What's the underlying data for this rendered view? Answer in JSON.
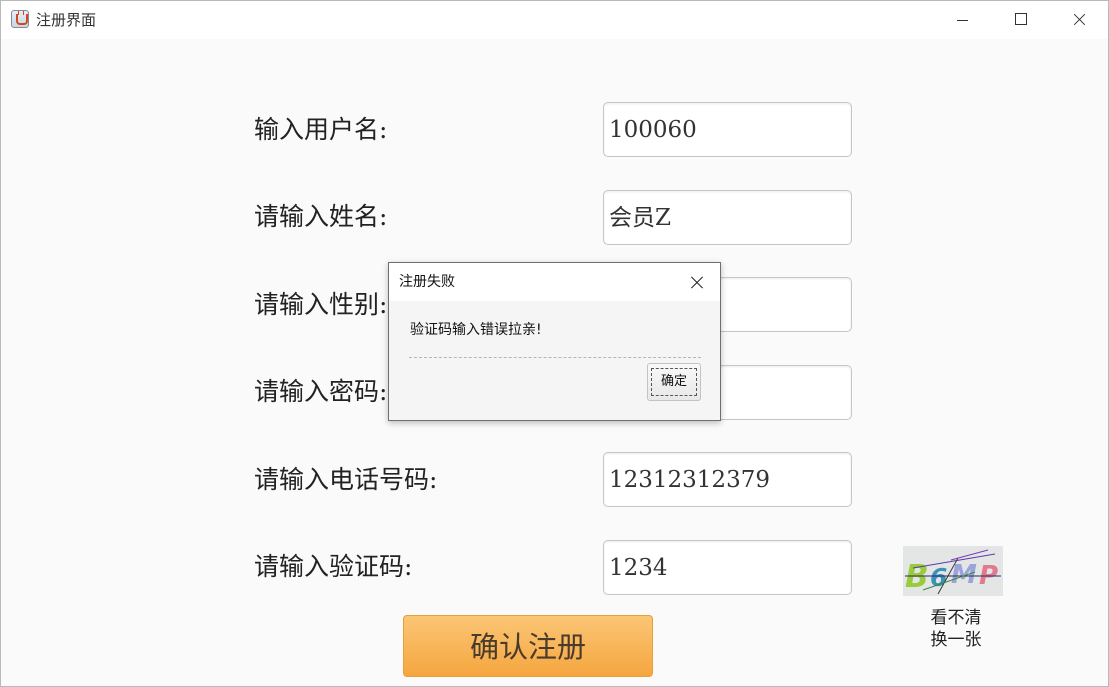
{
  "window": {
    "title": "注册界面"
  },
  "form": {
    "username_label": "输入用户名:",
    "username_value": "100060",
    "name_label": "请输入姓名:",
    "name_value": "会员Z",
    "gender_label": "请输入性别:",
    "password_label": "请输入密码:",
    "phone_label": "请输入电话号码:",
    "phone_value": "12312312379",
    "captcha_label": "请输入验证码:",
    "captcha_value": "1234",
    "captcha_image_text": "B6MP",
    "captcha_hint_line1": "看不清",
    "captcha_hint_line2": "换一张",
    "submit_label": "确认注册"
  },
  "dialog": {
    "title": "注册失败",
    "message": "验证码输入错误拉亲!",
    "ok_label": "确定"
  }
}
